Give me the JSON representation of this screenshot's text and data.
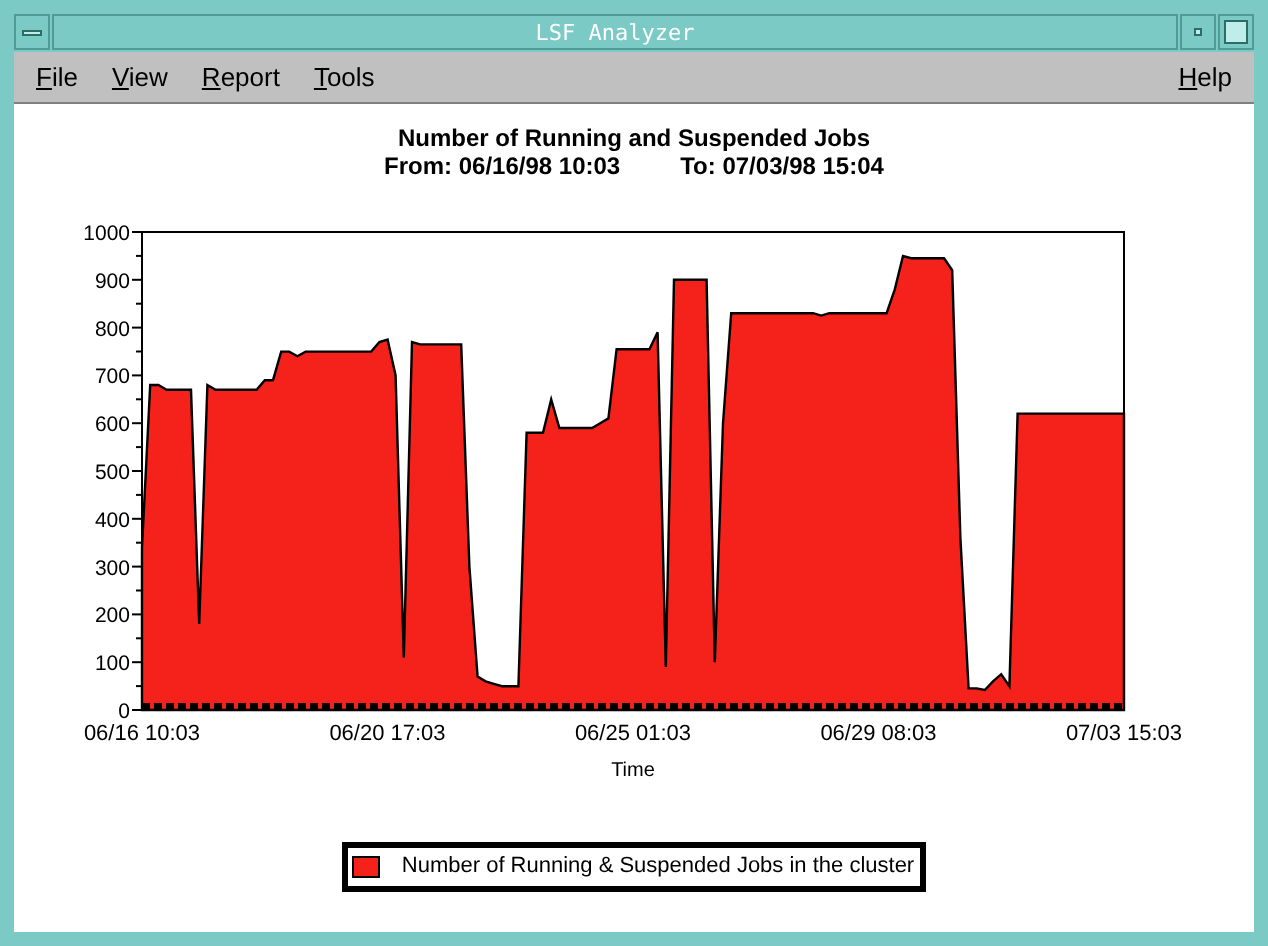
{
  "window": {
    "title": "LSF Analyzer"
  },
  "menu": [
    {
      "label": "File"
    },
    {
      "label": "View"
    },
    {
      "label": "Report"
    },
    {
      "label": "Tools"
    },
    {
      "label": "Help"
    }
  ],
  "subtitle": {
    "from": "From: 06/16/98 10:03",
    "to": "To: 07/03/98 15:04"
  },
  "chart_data": {
    "type": "area",
    "title": "Number of Running and Suspended Jobs",
    "xlabel": "Time",
    "ylim": [
      0,
      1000
    ],
    "yticks": [
      0,
      100,
      200,
      300,
      400,
      500,
      600,
      700,
      800,
      900,
      1000
    ],
    "categories": [
      "06/16 10:03",
      null,
      null,
      null,
      null,
      null,
      null,
      null,
      null,
      null,
      null,
      null,
      null,
      null,
      null,
      null,
      null,
      null,
      null,
      null,
      null,
      null,
      null,
      null,
      null,
      null,
      null,
      null,
      null,
      null,
      "06/20 17:03",
      null,
      null,
      null,
      null,
      null,
      null,
      null,
      null,
      null,
      null,
      null,
      null,
      null,
      null,
      null,
      null,
      null,
      null,
      null,
      null,
      null,
      null,
      null,
      null,
      null,
      null,
      null,
      null,
      null,
      "06/25 01:03",
      null,
      null,
      null,
      null,
      null,
      null,
      null,
      null,
      null,
      null,
      null,
      null,
      null,
      null,
      null,
      null,
      null,
      null,
      null,
      null,
      null,
      null,
      null,
      null,
      null,
      null,
      null,
      null,
      null,
      "06/29 08:03",
      null,
      null,
      null,
      null,
      null,
      null,
      null,
      null,
      null,
      null,
      null,
      null,
      null,
      null,
      null,
      null,
      null,
      null,
      null,
      null,
      null,
      null,
      null,
      null,
      null,
      null,
      null,
      null,
      null,
      "07/03 15:03"
    ],
    "series": [
      {
        "name": "Number of Running & Suspended Jobs in the cluster",
        "color": "#f5221b",
        "values": [
          340,
          680,
          680,
          670,
          670,
          670,
          670,
          180,
          680,
          670,
          670,
          670,
          670,
          670,
          670,
          690,
          690,
          750,
          750,
          740,
          750,
          750,
          750,
          750,
          750,
          750,
          750,
          750,
          750,
          770,
          775,
          700,
          110,
          770,
          765,
          765,
          765,
          765,
          765,
          765,
          300,
          70,
          60,
          55,
          50,
          50,
          50,
          580,
          580,
          580,
          650,
          590,
          590,
          590,
          590,
          590,
          600,
          610,
          755,
          755,
          755,
          755,
          755,
          790,
          90,
          900,
          900,
          900,
          900,
          900,
          100,
          600,
          830,
          830,
          830,
          830,
          830,
          830,
          830,
          830,
          830,
          830,
          830,
          825,
          830,
          830,
          830,
          830,
          830,
          830,
          830,
          830,
          880,
          950,
          945,
          945,
          945,
          945,
          945,
          920,
          360,
          45,
          45,
          42,
          60,
          75,
          50,
          620,
          620,
          620,
          620,
          620,
          620,
          620,
          620,
          620,
          620,
          620,
          620,
          620,
          620
        ]
      }
    ]
  }
}
